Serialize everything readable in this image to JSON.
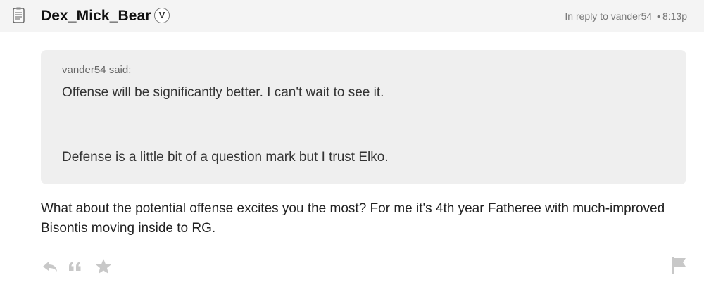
{
  "post": {
    "username": "Dex_Mick_Bear",
    "badge": "V",
    "reply_to_prefix": "In reply to",
    "reply_to_user": "vander54",
    "separator": "•",
    "time": "8:13p"
  },
  "quote": {
    "author": "vander54 said:",
    "lines": [
      "Offense will be significantly better. I can't wait to see it.",
      "Defense is a little bit of a question mark but I trust Elko."
    ]
  },
  "body": {
    "text": "What about the potential offense excites you the most? For me it's 4th year Fatheree with much-improved Bisontis moving inside to RG."
  },
  "actions": {
    "icons": [
      "reply-icon",
      "quote-icon",
      "star-icon",
      "flag-icon"
    ]
  },
  "colors": {
    "header_bg": "#f4f4f4",
    "quote_bg": "#efefef",
    "icon_gray": "#c8c8c8",
    "meta_gray": "#777777"
  }
}
